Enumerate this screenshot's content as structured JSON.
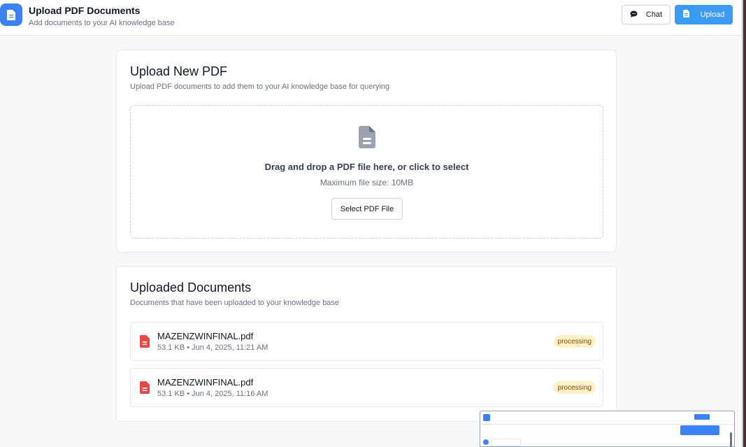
{
  "header": {
    "title": "Upload PDF Documents",
    "subtitle": "Add documents to your AI knowledge base",
    "chat_label": "Chat",
    "upload_label": "Upload"
  },
  "upload_card": {
    "title": "Upload New PDF",
    "description": "Upload PDF documents to add them to your AI knowledge base for querying",
    "dropzone_text": "Drag and drop a PDF file here, or click to select",
    "dropzone_sub": "Maximum file size: 10MB",
    "select_button": "Select PDF File"
  },
  "docs_card": {
    "title": "Uploaded Documents",
    "description": "Documents that have been uploaded to your knowledge base",
    "documents": [
      {
        "name": "MAZENZWINFINAL.pdf",
        "meta": "53.1 KB • Jun 4, 2025, 11:21 AM",
        "status": "processing"
      },
      {
        "name": "MAZENZWINFINAL.pdf",
        "meta": "53.1 KB • Jun 4, 2025, 11:16 AM",
        "status": "processing"
      }
    ]
  },
  "colors": {
    "primary": "#3b9bf2",
    "badge_bg": "#fef3c7",
    "pdf_icon": "#ef4444"
  },
  "icons": [
    "document-icon",
    "chat-bubble-icon",
    "file-icon",
    "pdf-file-icon"
  ]
}
